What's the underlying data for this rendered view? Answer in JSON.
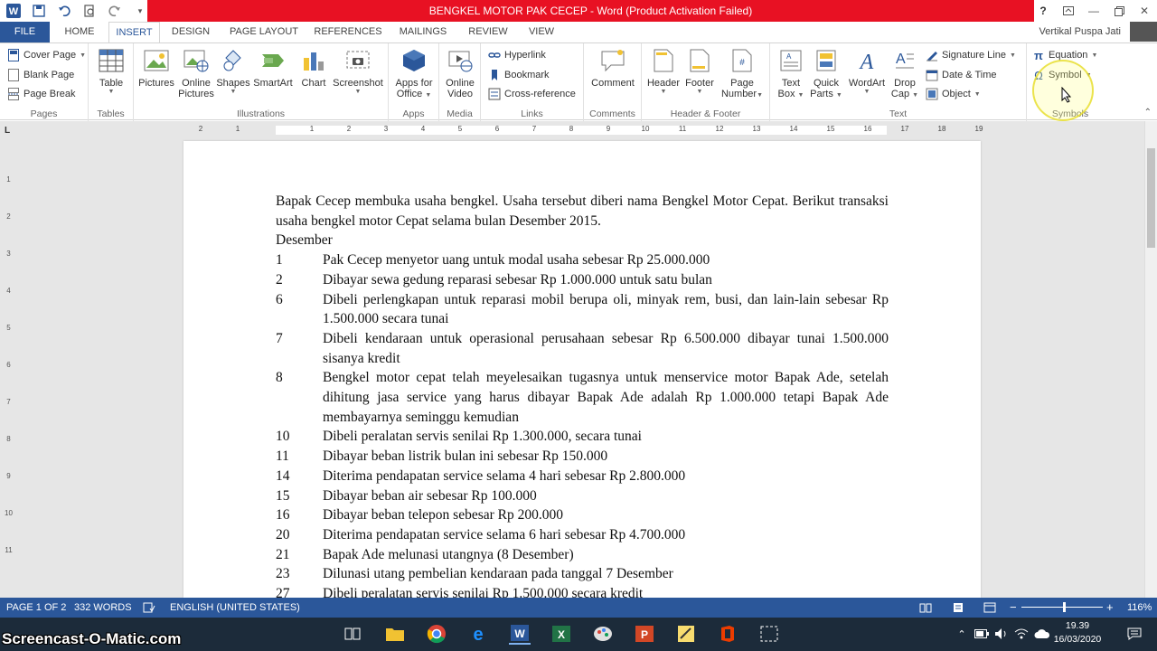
{
  "window": {
    "title": "BENGKEL MOTOR PAK CECEP -  Word (Product Activation Failed)",
    "user": "Vertikal Puspa Jati"
  },
  "quick_access": [
    {
      "icon": "word-logo-icon"
    },
    {
      "icon": "save-icon"
    },
    {
      "icon": "undo-icon"
    },
    {
      "icon": "print-preview-icon"
    },
    {
      "icon": "redo-icon"
    }
  ],
  "tabs": [
    "FILE",
    "HOME",
    "INSERT",
    "DESIGN",
    "PAGE LAYOUT",
    "REFERENCES",
    "MAILINGS",
    "REVIEW",
    "VIEW"
  ],
  "ribbon": {
    "pages": {
      "label": "Pages",
      "cover": "Cover Page",
      "blank": "Blank Page",
      "break": "Page Break"
    },
    "tables": {
      "label": "Tables",
      "table": "Table"
    },
    "illustrations": {
      "label": "Illustrations",
      "pictures": "Pictures",
      "online_pictures_1": "Online",
      "online_pictures_2": "Pictures",
      "shapes": "Shapes",
      "smartart": "SmartArt",
      "chart": "Chart",
      "screenshot": "Screenshot"
    },
    "apps": {
      "label": "Apps",
      "apps_1": "Apps for",
      "apps_2": "Office"
    },
    "media": {
      "label": "Media",
      "video_1": "Online",
      "video_2": "Video"
    },
    "links": {
      "label": "Links",
      "hyperlink": "Hyperlink",
      "bookmark": "Bookmark",
      "crossref": "Cross-reference"
    },
    "comments": {
      "label": "Comments",
      "comment": "Comment"
    },
    "header_footer": {
      "label": "Header & Footer",
      "header": "Header",
      "footer": "Footer",
      "page_number_1": "Page",
      "page_number_2": "Number"
    },
    "text": {
      "label": "Text",
      "textbox_1": "Text",
      "textbox_2": "Box",
      "quickparts_1": "Quick",
      "quickparts_2": "Parts",
      "wordart": "WordArt",
      "dropcap_1": "Drop",
      "dropcap_2": "Cap",
      "signature": "Signature Line",
      "datetime": "Date & Time",
      "object": "Object"
    },
    "symbols": {
      "label": "Symbols",
      "equation": "Equation",
      "symbol": "Symbol"
    }
  },
  "ruler": [
    "2",
    "1",
    "1",
    "2",
    "3",
    "4",
    "5",
    "6",
    "7",
    "8",
    "9",
    "10",
    "11",
    "12",
    "13",
    "14",
    "15",
    "16",
    "17",
    "18",
    "19"
  ],
  "vruler": [
    "1",
    "2",
    "3",
    "4",
    "5",
    "6",
    "7",
    "8",
    "9",
    "10",
    "11"
  ],
  "document": {
    "intro": "Bapak Cecep membuka usaha bengkel. Usaha tersebut diberi nama Bengkel Motor Cepat. Berikut transaksi usaha bengkel motor Cepat selama bulan Desember 2015.",
    "month": "Desember",
    "entries": [
      {
        "day": "1",
        "text": "Pak Cecep menyetor uang untuk modal usaha sebesar Rp 25.000.000"
      },
      {
        "day": "2",
        "text": "Dibayar sewa gedung reparasi sebesar Rp 1.000.000 untuk satu bulan"
      },
      {
        "day": "6",
        "text": "Dibeli perlengkapan untuk reparasi mobil berupa oli, minyak rem, busi, dan lain-lain sebesar Rp 1.500.000 secara tunai"
      },
      {
        "day": "7",
        "text": "Dibeli kendaraan untuk operasional perusahaan sebesar Rp 6.500.000 dibayar tunai 1.500.000 sisanya kredit"
      },
      {
        "day": "8",
        "text": "Bengkel motor cepat telah meyelesaikan tugasnya untuk menservice motor Bapak Ade, setelah dihitung jasa service yang harus dibayar Bapak Ade adalah Rp 1.000.000 tetapi Bapak Ade membayarnya seminggu kemudian"
      },
      {
        "day": "10",
        "text": "Dibeli peralatan servis senilai Rp 1.300.000, secara tunai"
      },
      {
        "day": "11",
        "text": "Dibayar beban listrik bulan ini sebesar Rp 150.000"
      },
      {
        "day": "14",
        "text": "Diterima pendapatan service selama 4 hari sebesar Rp 2.800.000"
      },
      {
        "day": "15",
        "text": "Dibayar beban air sebesar Rp 100.000"
      },
      {
        "day": "16",
        "text": "Dibayar beban telepon sebesar Rp 200.000"
      },
      {
        "day": "20",
        "text": "Diterima pendapatan service selama 6 hari sebesar Rp 4.700.000"
      },
      {
        "day": "21",
        "text": "Bapak Ade melunasi utangnya (8 Desember)"
      },
      {
        "day": "23",
        "text": "Dilunasi utang pembelian kendaraan pada tanggal 7 Desember"
      },
      {
        "day": "27",
        "text": "Dibeli peralatan servis senilai Rp 1.500.000 secara kredit"
      }
    ]
  },
  "status": {
    "page": "PAGE 1 OF 2",
    "words": "332 WORDS",
    "language": "ENGLISH (UNITED STATES)",
    "zoom": "116%"
  },
  "taskbar": {
    "watermark": "Screencast-O-Matic.com",
    "time": "19.39",
    "date": "16/03/2020"
  }
}
